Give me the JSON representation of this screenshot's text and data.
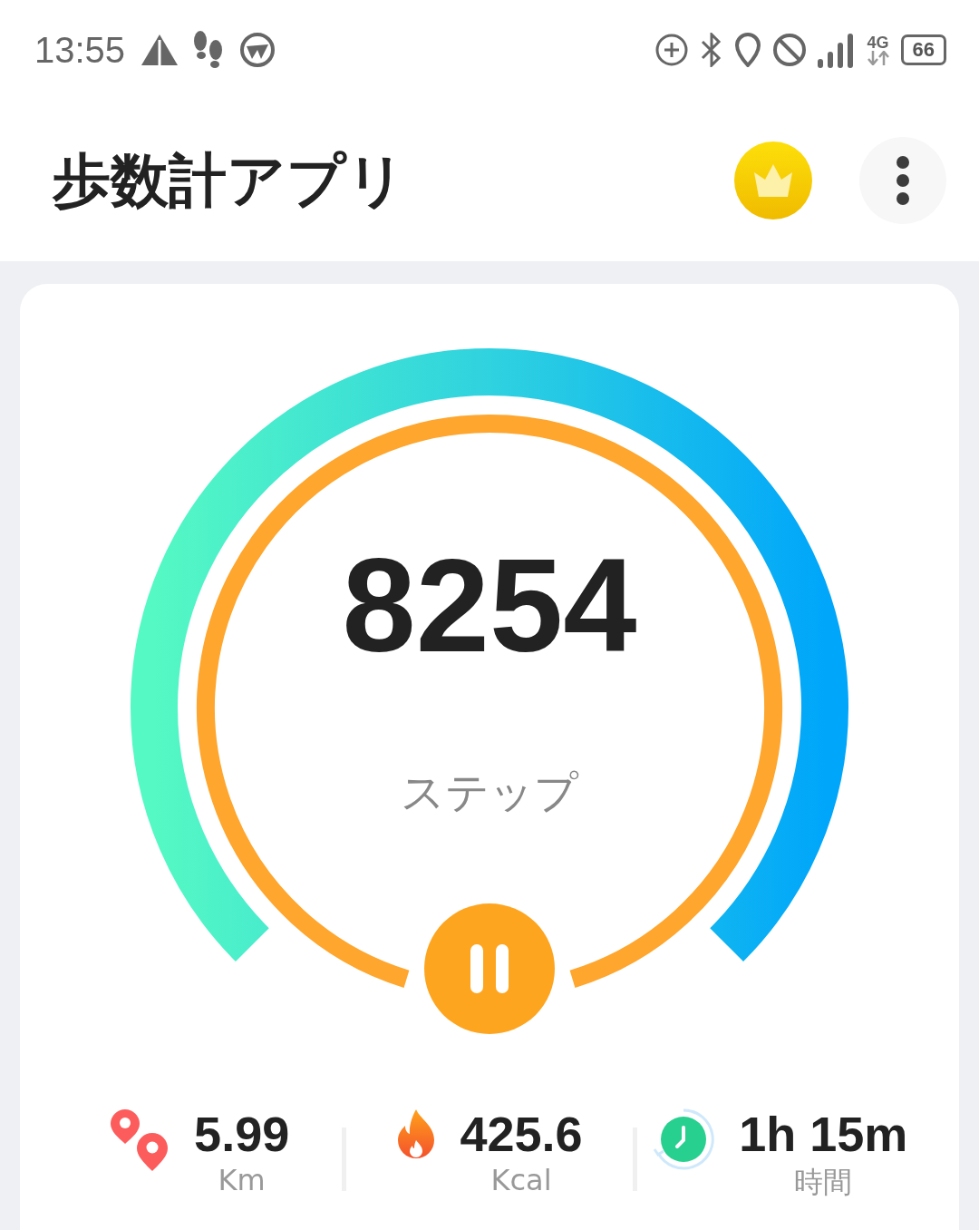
{
  "status_bar": {
    "time": "13:55",
    "network": "4G",
    "battery": "66"
  },
  "header": {
    "title": "歩数計アプリ"
  },
  "gauge": {
    "steps": "8254",
    "unit": "ステップ"
  },
  "stats": [
    {
      "kind": "distance",
      "value": "5.99",
      "label": "Km"
    },
    {
      "kind": "calories",
      "value": "425.6",
      "label": "Kcal"
    },
    {
      "kind": "time",
      "value": "1h 15m",
      "label": "時間"
    }
  ]
}
